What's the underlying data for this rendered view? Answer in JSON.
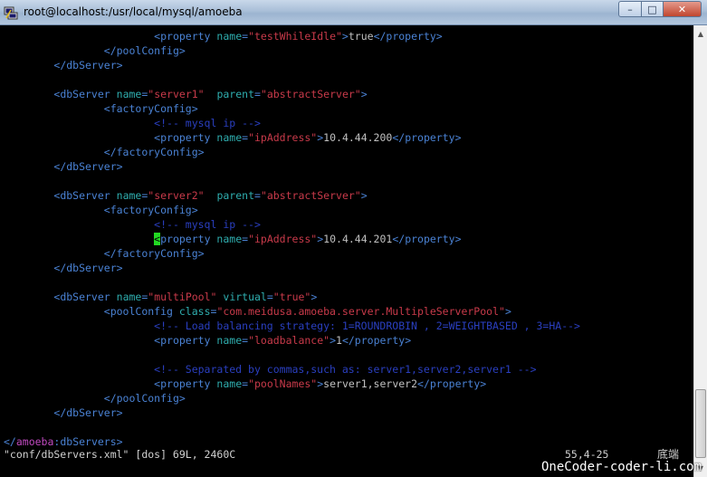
{
  "window": {
    "title": "root@localhost:/usr/local/mysql/amoeba",
    "icon": "putty-icon",
    "buttons": {
      "minimize": "–",
      "maximize": "□",
      "close": "✕"
    }
  },
  "editor": {
    "lines": [
      [
        {
          "s": "                        ",
          "k": "x"
        },
        {
          "s": "<property ",
          "k": "t"
        },
        {
          "s": "name",
          "k": "a"
        },
        {
          "s": "=",
          "k": "t"
        },
        {
          "s": "\"testWhileIdle\"",
          "k": "v"
        },
        {
          "s": ">",
          "k": "t"
        },
        {
          "s": "true",
          "k": "x"
        },
        {
          "s": "</property>",
          "k": "t"
        }
      ],
      [
        {
          "s": "                ",
          "k": "x"
        },
        {
          "s": "</poolConfig>",
          "k": "t"
        }
      ],
      [
        {
          "s": "        ",
          "k": "x"
        },
        {
          "s": "</dbServer>",
          "k": "t"
        }
      ],
      [],
      [
        {
          "s": "        ",
          "k": "x"
        },
        {
          "s": "<dbServer ",
          "k": "t"
        },
        {
          "s": "name",
          "k": "a"
        },
        {
          "s": "=",
          "k": "t"
        },
        {
          "s": "\"server1\"",
          "k": "v"
        },
        {
          "s": "  ",
          "k": "x"
        },
        {
          "s": "parent",
          "k": "a"
        },
        {
          "s": "=",
          "k": "t"
        },
        {
          "s": "\"abstractServer\"",
          "k": "v"
        },
        {
          "s": ">",
          "k": "t"
        }
      ],
      [
        {
          "s": "                ",
          "k": "x"
        },
        {
          "s": "<factoryConfig>",
          "k": "t"
        }
      ],
      [
        {
          "s": "                        ",
          "k": "x"
        },
        {
          "s": "<!-- mysql ip -->",
          "k": "c"
        }
      ],
      [
        {
          "s": "                        ",
          "k": "x"
        },
        {
          "s": "<property ",
          "k": "t"
        },
        {
          "s": "name",
          "k": "a"
        },
        {
          "s": "=",
          "k": "t"
        },
        {
          "s": "\"ipAddress\"",
          "k": "v"
        },
        {
          "s": ">",
          "k": "t"
        },
        {
          "s": "10.4.44.200",
          "k": "x"
        },
        {
          "s": "</property>",
          "k": "t"
        }
      ],
      [
        {
          "s": "                ",
          "k": "x"
        },
        {
          "s": "</factoryConfig>",
          "k": "t"
        }
      ],
      [
        {
          "s": "        ",
          "k": "x"
        },
        {
          "s": "</dbServer>",
          "k": "t"
        }
      ],
      [],
      [
        {
          "s": "        ",
          "k": "x"
        },
        {
          "s": "<dbServer ",
          "k": "t"
        },
        {
          "s": "name",
          "k": "a"
        },
        {
          "s": "=",
          "k": "t"
        },
        {
          "s": "\"server2\"",
          "k": "v"
        },
        {
          "s": "  ",
          "k": "x"
        },
        {
          "s": "parent",
          "k": "a"
        },
        {
          "s": "=",
          "k": "t"
        },
        {
          "s": "\"abstractServer\"",
          "k": "v"
        },
        {
          "s": ">",
          "k": "t"
        }
      ],
      [
        {
          "s": "                ",
          "k": "x"
        },
        {
          "s": "<factoryConfig>",
          "k": "t"
        }
      ],
      [
        {
          "s": "                        ",
          "k": "x"
        },
        {
          "s": "<!-- mysql ip -->",
          "k": "c"
        }
      ],
      [
        {
          "s": "                        ",
          "k": "x"
        },
        {
          "s": "<",
          "k": "cursor"
        },
        {
          "s": "property ",
          "k": "t"
        },
        {
          "s": "name",
          "k": "a"
        },
        {
          "s": "=",
          "k": "t"
        },
        {
          "s": "\"ipAddress\"",
          "k": "v"
        },
        {
          "s": ">",
          "k": "t"
        },
        {
          "s": "10.4.44.201",
          "k": "x"
        },
        {
          "s": "</property>",
          "k": "t"
        }
      ],
      [
        {
          "s": "                ",
          "k": "x"
        },
        {
          "s": "</factoryConfig>",
          "k": "t"
        }
      ],
      [
        {
          "s": "        ",
          "k": "x"
        },
        {
          "s": "</dbServer>",
          "k": "t"
        }
      ],
      [],
      [
        {
          "s": "        ",
          "k": "x"
        },
        {
          "s": "<dbServer ",
          "k": "t"
        },
        {
          "s": "name",
          "k": "a"
        },
        {
          "s": "=",
          "k": "t"
        },
        {
          "s": "\"multiPool\"",
          "k": "v"
        },
        {
          "s": " ",
          "k": "x"
        },
        {
          "s": "virtual",
          "k": "a"
        },
        {
          "s": "=",
          "k": "t"
        },
        {
          "s": "\"true\"",
          "k": "v"
        },
        {
          "s": ">",
          "k": "t"
        }
      ],
      [
        {
          "s": "                ",
          "k": "x"
        },
        {
          "s": "<poolConfig ",
          "k": "t"
        },
        {
          "s": "class",
          "k": "a"
        },
        {
          "s": "=",
          "k": "t"
        },
        {
          "s": "\"com.meidusa.amoeba.server.MultipleServerPool\"",
          "k": "v"
        },
        {
          "s": ">",
          "k": "t"
        }
      ],
      [
        {
          "s": "                        ",
          "k": "x"
        },
        {
          "s": "<!-- Load balancing strategy: 1=ROUNDROBIN , 2=WEIGHTBASED , 3=HA-->",
          "k": "c"
        }
      ],
      [
        {
          "s": "                        ",
          "k": "x"
        },
        {
          "s": "<property ",
          "k": "t"
        },
        {
          "s": "name",
          "k": "a"
        },
        {
          "s": "=",
          "k": "t"
        },
        {
          "s": "\"loadbalance\"",
          "k": "v"
        },
        {
          "s": ">",
          "k": "t"
        },
        {
          "s": "1",
          "k": "x"
        },
        {
          "s": "</property>",
          "k": "t"
        }
      ],
      [],
      [
        {
          "s": "                        ",
          "k": "x"
        },
        {
          "s": "<!-- Separated by commas,such as: server1,server2,server1 -->",
          "k": "c"
        }
      ],
      [
        {
          "s": "                        ",
          "k": "x"
        },
        {
          "s": "<property ",
          "k": "t"
        },
        {
          "s": "name",
          "k": "a"
        },
        {
          "s": "=",
          "k": "t"
        },
        {
          "s": "\"poolNames\"",
          "k": "v"
        },
        {
          "s": ">",
          "k": "t"
        },
        {
          "s": "server1,server2",
          "k": "x"
        },
        {
          "s": "</property>",
          "k": "t"
        }
      ],
      [
        {
          "s": "                ",
          "k": "x"
        },
        {
          "s": "</poolConfig>",
          "k": "t"
        }
      ],
      [
        {
          "s": "        ",
          "k": "x"
        },
        {
          "s": "</dbServer>",
          "k": "t"
        }
      ],
      [],
      [
        {
          "s": "</",
          "k": "t"
        },
        {
          "s": "amoeba",
          "k": "p"
        },
        {
          "s": ":",
          "k": "t"
        },
        {
          "s": "dbServers",
          "k": "t"
        },
        {
          "s": ">",
          "k": "t"
        }
      ]
    ],
    "status": {
      "file": "\"conf/dbServers.xml\" [dos] 69L, 2460C",
      "position": "55,4-25",
      "scroll": "底端"
    }
  },
  "watermark": "OneCoder-coder-li.com",
  "colors": {
    "tag": "#4a82d4",
    "attr": "#2faeaf",
    "value": "#c83a4a",
    "comment": "#2a3fc0",
    "cursor": "#22d822"
  }
}
